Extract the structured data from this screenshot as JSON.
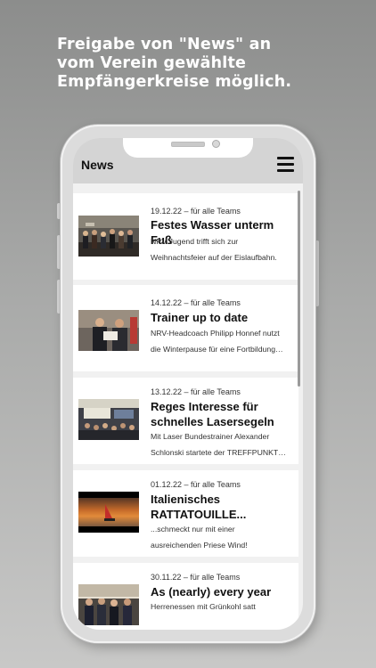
{
  "promo": {
    "lines": [
      "Freigabe von \"News\" an",
      "vom Verein gewählte",
      "Empfängerkreise möglich."
    ]
  },
  "app": {
    "title": "News",
    "menu_icon": "hamburger-icon"
  },
  "news": [
    {
      "meta": "19.12.22 – für alle Teams",
      "title": "Festes Wasser unterm Fuß",
      "desc_lines": [
        "NRV Jugend trifft sich zur",
        "Weihnachtsfeier auf der Eislaufbahn."
      ]
    },
    {
      "meta": "14.12.22 – für alle Teams",
      "title": "Trainer up to date",
      "desc_lines": [
        "NRV-Headcoach Philipp Honnef nutzt",
        "die Winterpause für eine Fortbildung…"
      ]
    },
    {
      "meta": "13.12.22 – für alle Teams",
      "title_lines": [
        "Reges Interesse für",
        "schnelles Lasersegeln"
      ],
      "desc_lines": [
        "Mit Laser Bundestrainer Alexander",
        "Schlonski startete der TREFFPUNKT…"
      ]
    },
    {
      "meta": "01.12.22 – für alle Teams",
      "title_lines": [
        "Italienisches",
        "RATTATOUILLE..."
      ],
      "desc_lines": [
        "...schmeckt nur mit einer",
        "ausreichenden Priese Wind!"
      ]
    },
    {
      "meta": "30.11.22 – für alle Teams",
      "title": "As (nearly) every year",
      "desc_lines": [
        "Herrenessen mit Grünkohl satt"
      ]
    }
  ],
  "colors": {
    "appbar": "#d4d4d4",
    "background_top": "#8c8d8c",
    "background_bottom": "#c8c8c7"
  }
}
